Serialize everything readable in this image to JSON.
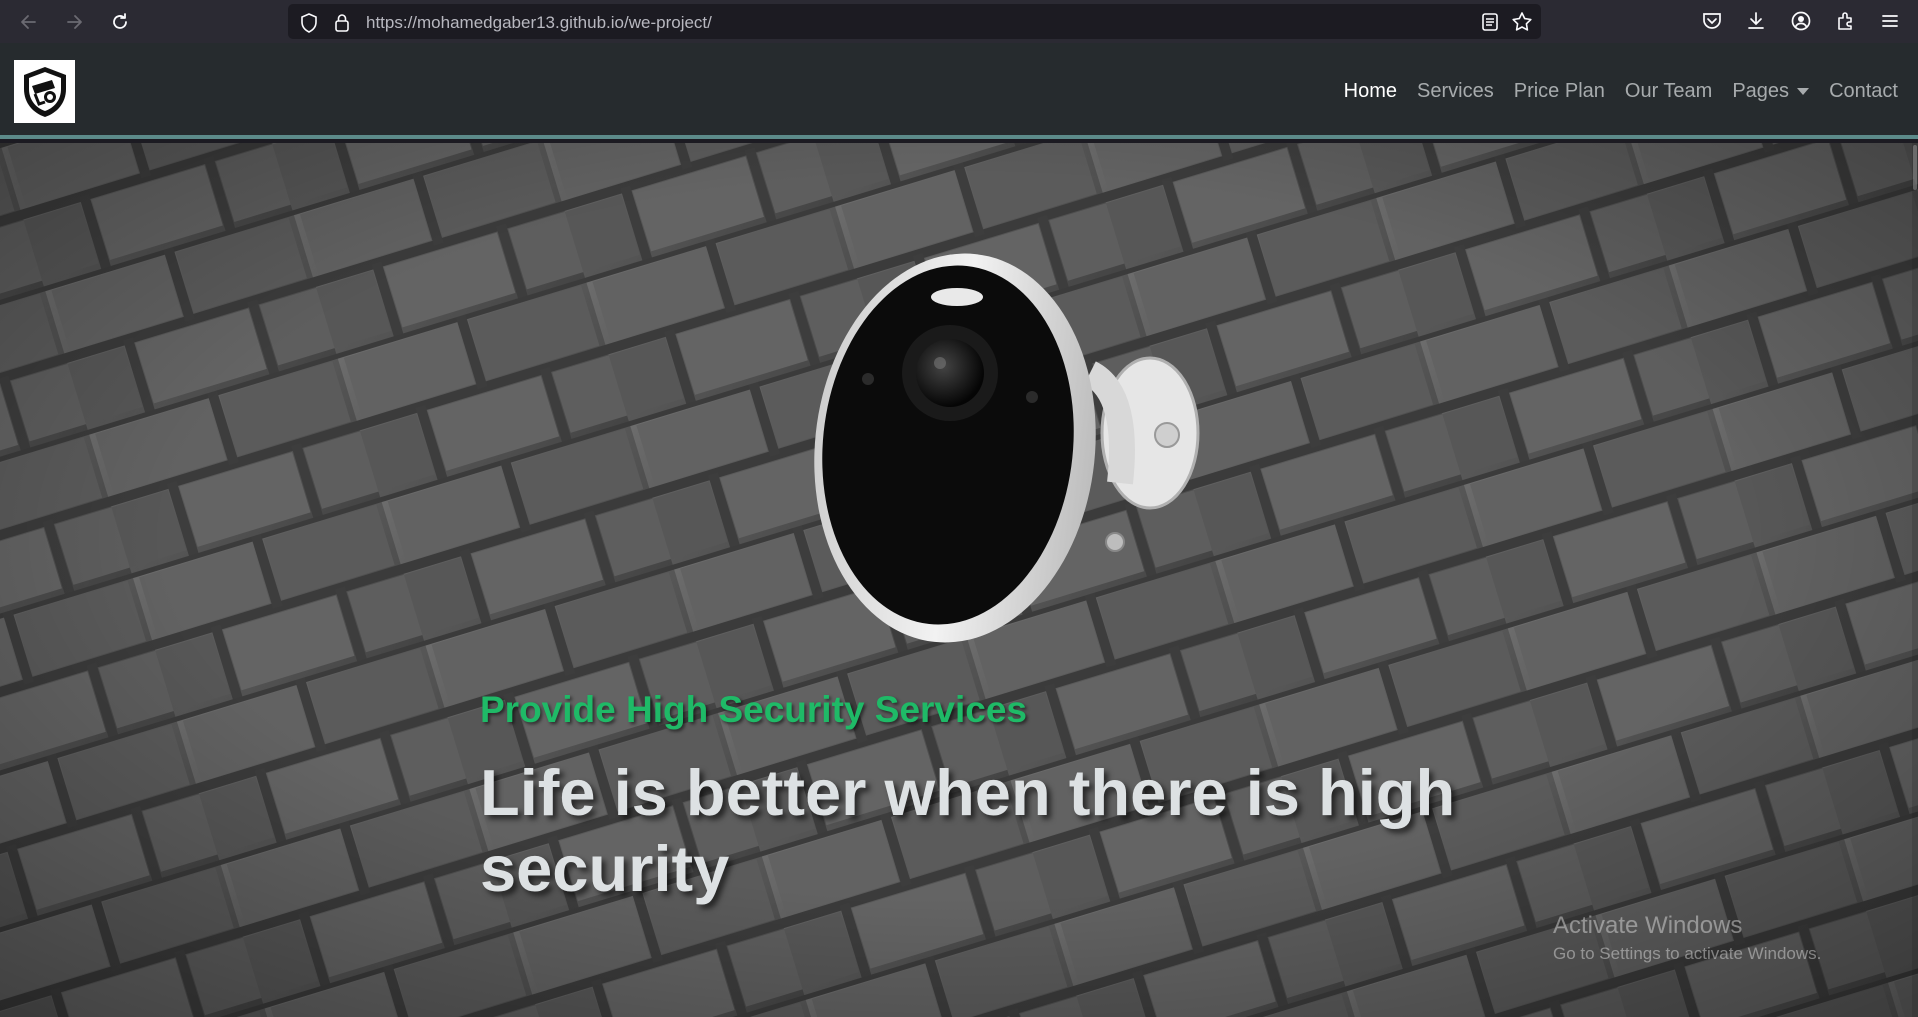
{
  "browser": {
    "url_host": "https://mohamedgaber13.github.io",
    "url_path": "/we-project/",
    "icons": [
      "back-icon",
      "forward-icon",
      "reload-icon",
      "shield-icon",
      "lock-icon",
      "reader-view-icon",
      "bookmark-star-icon",
      "pocket-icon",
      "downloads-icon",
      "account-icon",
      "extensions-icon",
      "menu-icon"
    ]
  },
  "site": {
    "nav": {
      "home": "Home",
      "services": "Services",
      "price_plan": "Price Plan",
      "our_team": "Our Team",
      "pages": "Pages",
      "contact": "Contact"
    },
    "hero": {
      "subtitle": "Provide High Security Services",
      "title": "Life is better when there is high security"
    },
    "colors": {
      "nav_bg": "#262b2e",
      "accent_green": "#1fba67",
      "nav_border": "#5c8b8a"
    }
  },
  "os": {
    "watermark_title": "Activate Windows",
    "watermark_sub": "Go to Settings to activate Windows."
  }
}
